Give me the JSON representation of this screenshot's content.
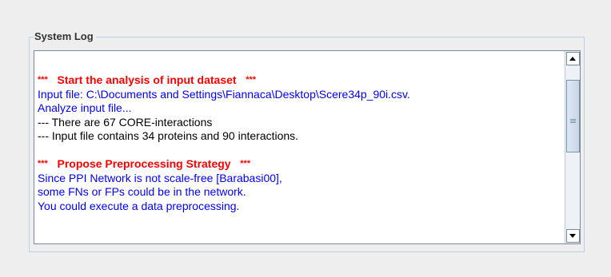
{
  "panel": {
    "title": "System Log"
  },
  "log": {
    "line1": {
      "prefix": "***",
      "text": "Start the analysis of input dataset",
      "suffix": "***"
    },
    "line2": "Input file: C:\\Documents and Settings\\Fiannaca\\Desktop\\Scere34p_90i.csv.",
    "line3": "Analyze input file...",
    "line4": "--- There are 67 CORE-interactions",
    "line5": "--- Input file contains 34 proteins and 90 interactions.",
    "line7": {
      "prefix": "***",
      "text": "Propose Preprocessing Strategy",
      "suffix": "***"
    },
    "line8": "Since PPI Network is not scale-free [Barabasi00],",
    "line9": "some FNs or FPs could be in the network.",
    "line10": "You could execute a data preprocessing."
  },
  "scrollbar": {
    "position_fraction": 0.15,
    "visible_fraction": 0.45
  },
  "colors": {
    "heading": "#ff0000",
    "info": "#0000ff",
    "detail": "#000000",
    "panel_border": "#b8cfe5"
  }
}
